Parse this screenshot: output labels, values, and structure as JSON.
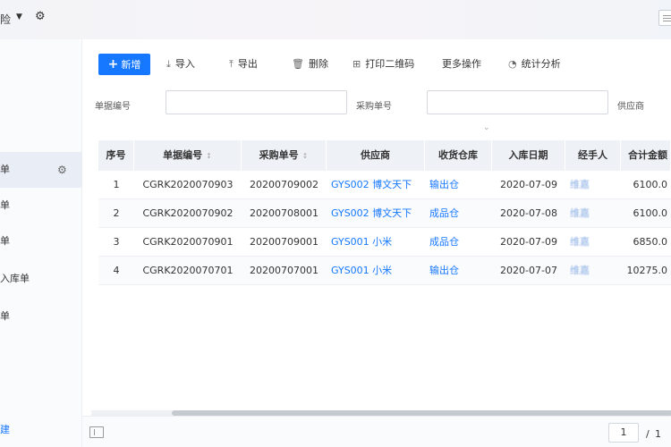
{
  "topbar": {
    "title": "险",
    "caret": "▼",
    "gear": "⚙"
  },
  "sidebar": {
    "items": [
      {
        "label": "单",
        "active": true
      },
      {
        "label": "单",
        "active": false
      },
      {
        "label": "单",
        "active": false
      },
      {
        "label": "入库单",
        "active": false
      },
      {
        "label": "单",
        "active": false
      }
    ],
    "gear": "⚙",
    "bottom_label": "建"
  },
  "toolbar": {
    "add": {
      "icon": "+",
      "label": "新增"
    },
    "import": {
      "icon": "⤓",
      "label": "导入"
    },
    "export": {
      "icon": "⤒",
      "label": "导出"
    },
    "delete": {
      "icon": "🗑",
      "label": "删除"
    },
    "print_qr": {
      "icon": "⊞",
      "label": "打印二维码"
    },
    "more": {
      "label": "更多操作"
    },
    "stats": {
      "icon": "◔",
      "label": "统计分析"
    }
  },
  "filters": {
    "doc_no_label": "单据编号",
    "purchase_no_label": "采购单号",
    "supplier_label": "供应商",
    "doc_no_value": "",
    "purchase_no_value": ""
  },
  "table": {
    "headers": [
      "序号",
      "单据编号",
      "采购单号",
      "供应商",
      "收货仓库",
      "入库日期",
      "经手人",
      "合计金额"
    ],
    "sort_icon": "↕",
    "rows": [
      {
        "no": "1",
        "doc_no": "CGRK2020070903",
        "purchase_no": "20200709002",
        "supplier": "GYS002 博文天下",
        "warehouse": "输出仓",
        "date": "2020-07-09",
        "handler": "维嘉",
        "amount": "6100.0"
      },
      {
        "no": "2",
        "doc_no": "CGRK2020070902",
        "purchase_no": "20200708001",
        "supplier": "GYS002 博文天下",
        "warehouse": "成品仓",
        "date": "2020-07-08",
        "handler": "维嘉",
        "amount": "6100.0"
      },
      {
        "no": "3",
        "doc_no": "CGRK2020070901",
        "purchase_no": "20200709001",
        "supplier": "GYS001 小米",
        "warehouse": "成品仓",
        "date": "2020-07-09",
        "handler": "维嘉",
        "amount": "6850.0"
      },
      {
        "no": "4",
        "doc_no": "CGRK2020070701",
        "purchase_no": "20200707001",
        "supplier": "GYS001 小米",
        "warehouse": "输出仓",
        "date": "2020-07-07",
        "handler": "维嘉",
        "amount": "10275.0"
      }
    ]
  },
  "pagination": {
    "current": "1",
    "separator": "/",
    "total": "1"
  }
}
